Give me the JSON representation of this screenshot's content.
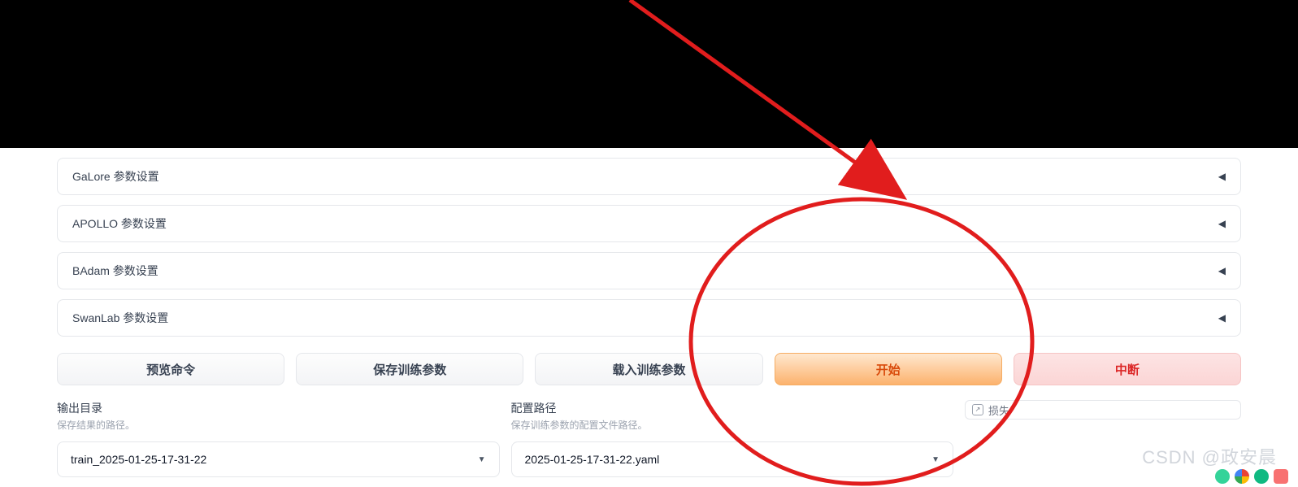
{
  "accordions": [
    {
      "label": "GaLore 参数设置"
    },
    {
      "label": "APOLLO 参数设置"
    },
    {
      "label": "BAdam 参数设置"
    },
    {
      "label": "SwanLab 参数设置"
    }
  ],
  "buttons": {
    "preview": "预览命令",
    "save": "保存训练参数",
    "load": "载入训练参数",
    "start": "开始",
    "abort": "中断"
  },
  "output_dir": {
    "label": "输出目录",
    "desc": "保存结果的路径。",
    "value": "train_2025-01-25-17-31-22"
  },
  "config_path": {
    "label": "配置路径",
    "desc": "保存训练参数的配置文件路径。",
    "value": "2025-01-25-17-31-22.yaml"
  },
  "loss_panel_label": "损失",
  "watermark": "CSDN @政安晨"
}
